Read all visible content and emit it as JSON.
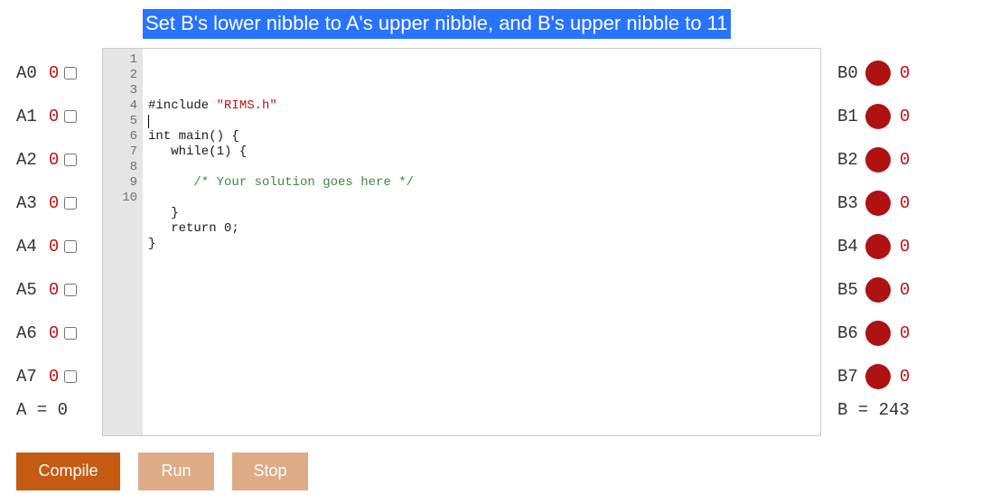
{
  "title": "Set B's lower nibble to A's upper nibble, and B's upper nibble to 11",
  "inputs": [
    {
      "label": "A0",
      "value": "0"
    },
    {
      "label": "A1",
      "value": "0"
    },
    {
      "label": "A2",
      "value": "0"
    },
    {
      "label": "A3",
      "value": "0"
    },
    {
      "label": "A4",
      "value": "0"
    },
    {
      "label": "A5",
      "value": "0"
    },
    {
      "label": "A6",
      "value": "0"
    },
    {
      "label": "A7",
      "value": "0"
    }
  ],
  "input_total": "A = 0",
  "outputs": [
    {
      "label": "B0",
      "value": "0"
    },
    {
      "label": "B1",
      "value": "0"
    },
    {
      "label": "B2",
      "value": "0"
    },
    {
      "label": "B3",
      "value": "0"
    },
    {
      "label": "B4",
      "value": "0"
    },
    {
      "label": "B5",
      "value": "0"
    },
    {
      "label": "B6",
      "value": "0"
    },
    {
      "label": "B7",
      "value": "0"
    }
  ],
  "output_total": "B = 243",
  "code": {
    "lines": [
      {
        "n": "1",
        "segments": [
          [
            "#include ",
            "plain"
          ],
          [
            "\"RIMS.h\"",
            "string"
          ]
        ]
      },
      {
        "n": "2",
        "segments": []
      },
      {
        "n": "3",
        "segments": [
          [
            "int main() {",
            "plain"
          ]
        ]
      },
      {
        "n": "4",
        "segments": [
          [
            "   while(1) {",
            "plain"
          ]
        ]
      },
      {
        "n": "5",
        "segments": []
      },
      {
        "n": "6",
        "segments": [
          [
            "      /* Your solution goes here */",
            "comment"
          ]
        ]
      },
      {
        "n": "7",
        "segments": []
      },
      {
        "n": "8",
        "segments": [
          [
            "   }",
            "plain"
          ]
        ]
      },
      {
        "n": "9",
        "segments": [
          [
            "   return 0;",
            "plain"
          ]
        ]
      },
      {
        "n": "10",
        "segments": [
          [
            "}",
            "plain"
          ]
        ]
      }
    ]
  },
  "buttons": {
    "compile": "Compile",
    "run": "Run",
    "stop": "Stop"
  }
}
